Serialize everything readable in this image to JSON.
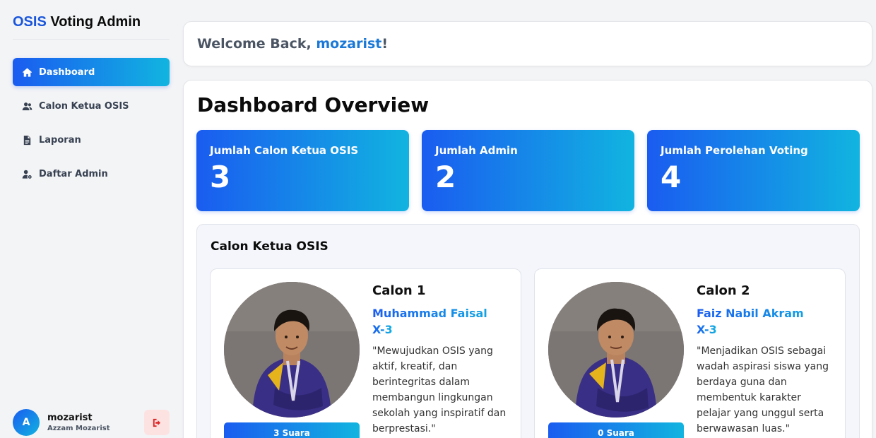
{
  "brand": {
    "accent": "OSIS",
    "rest": " Voting Admin"
  },
  "sidebar": {
    "items": [
      {
        "label": "Dashboard",
        "icon": "home-icon",
        "active": true
      },
      {
        "label": "Calon Ketua OSIS",
        "icon": "users-icon",
        "active": false
      },
      {
        "label": "Laporan",
        "icon": "file-icon",
        "active": false
      },
      {
        "label": "Daftar Admin",
        "icon": "user-gear-icon",
        "active": false
      }
    ]
  },
  "user": {
    "initial": "A",
    "username": "mozarist",
    "full_name": "Azzam Mozarist"
  },
  "welcome": {
    "prefix": "Welcome Back, ",
    "username": "mozarist",
    "suffix": "!"
  },
  "dashboard": {
    "title": "Dashboard Overview",
    "stats": [
      {
        "label": "Jumlah Calon Ketua OSIS",
        "value": "3"
      },
      {
        "label": "Jumlah Admin",
        "value": "2"
      },
      {
        "label": "Jumlah Perolehan Voting",
        "value": "4"
      }
    ]
  },
  "candidates": {
    "title": "Calon Ketua OSIS",
    "list": [
      {
        "number": "Calon 1",
        "name": "Muhammad Faisal",
        "class": "X-3",
        "quote": "\"Mewujudkan OSIS yang aktif, kreatif, dan berintegritas dalam membangun lingkungan sekolah yang inspiratif dan berprestasi.\"",
        "votes": "3 Suara"
      },
      {
        "number": "Calon 2",
        "name": "Faiz Nabil Akram",
        "class": "X-3",
        "quote": "\"Menjadikan OSIS sebagai wadah aspirasi siswa yang berdaya guna dan membentuk karakter pelajar yang unggul serta berwawasan luas.\"",
        "votes": "0 Suara"
      }
    ]
  },
  "colors": {
    "accent_start": "#1a5cf0",
    "accent_end": "#11b4e0",
    "logout_bg": "#fde2e2",
    "logout_icon": "#dc2626"
  }
}
